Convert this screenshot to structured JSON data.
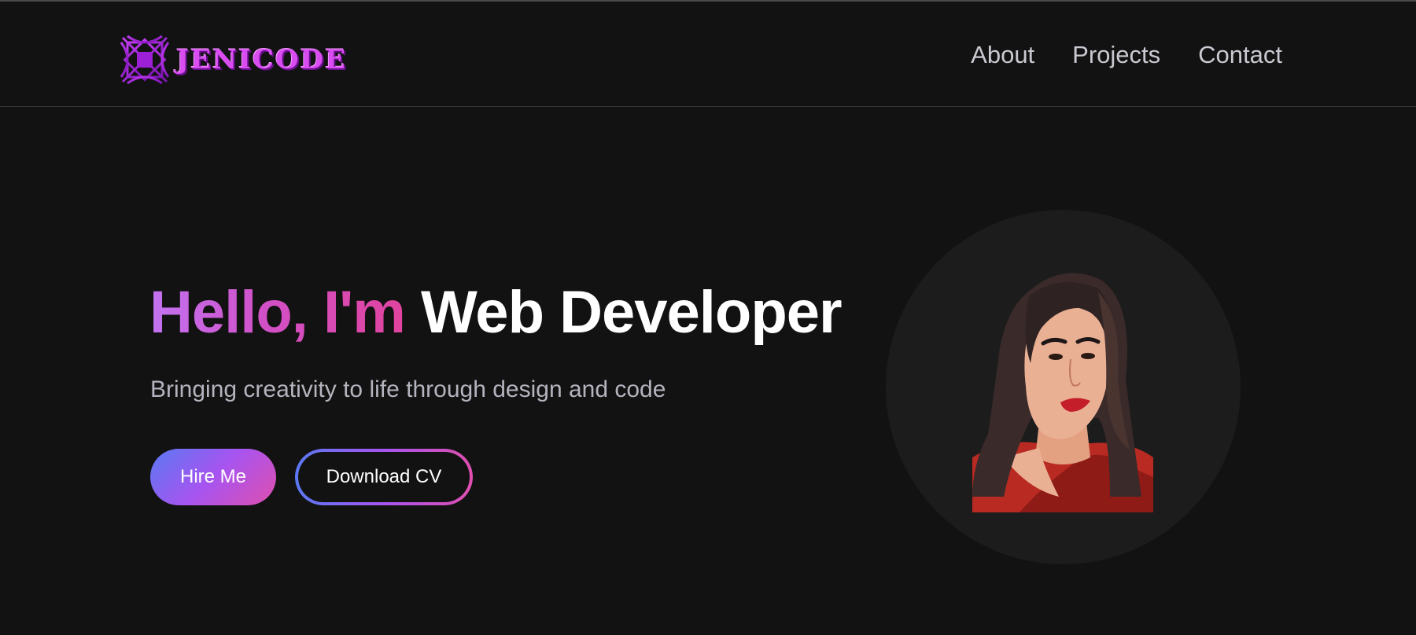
{
  "brand": {
    "name": "JENICODE",
    "colors": {
      "primary": "#d84cf0",
      "dark": "#6a0f8f"
    }
  },
  "nav": {
    "links": [
      {
        "label": "About"
      },
      {
        "label": "Projects"
      },
      {
        "label": "Contact"
      }
    ]
  },
  "hero": {
    "greeting": "Hello, I'm",
    "role": "Web Developer",
    "subtitle": "Bringing creativity to life through design and code",
    "primary_button": "Hire Me",
    "secondary_button": "Download CV",
    "gradient": [
      "#5a79f2",
      "#a754f0",
      "#df4fae"
    ]
  },
  "portrait": {
    "icon": "portrait-illustration"
  }
}
